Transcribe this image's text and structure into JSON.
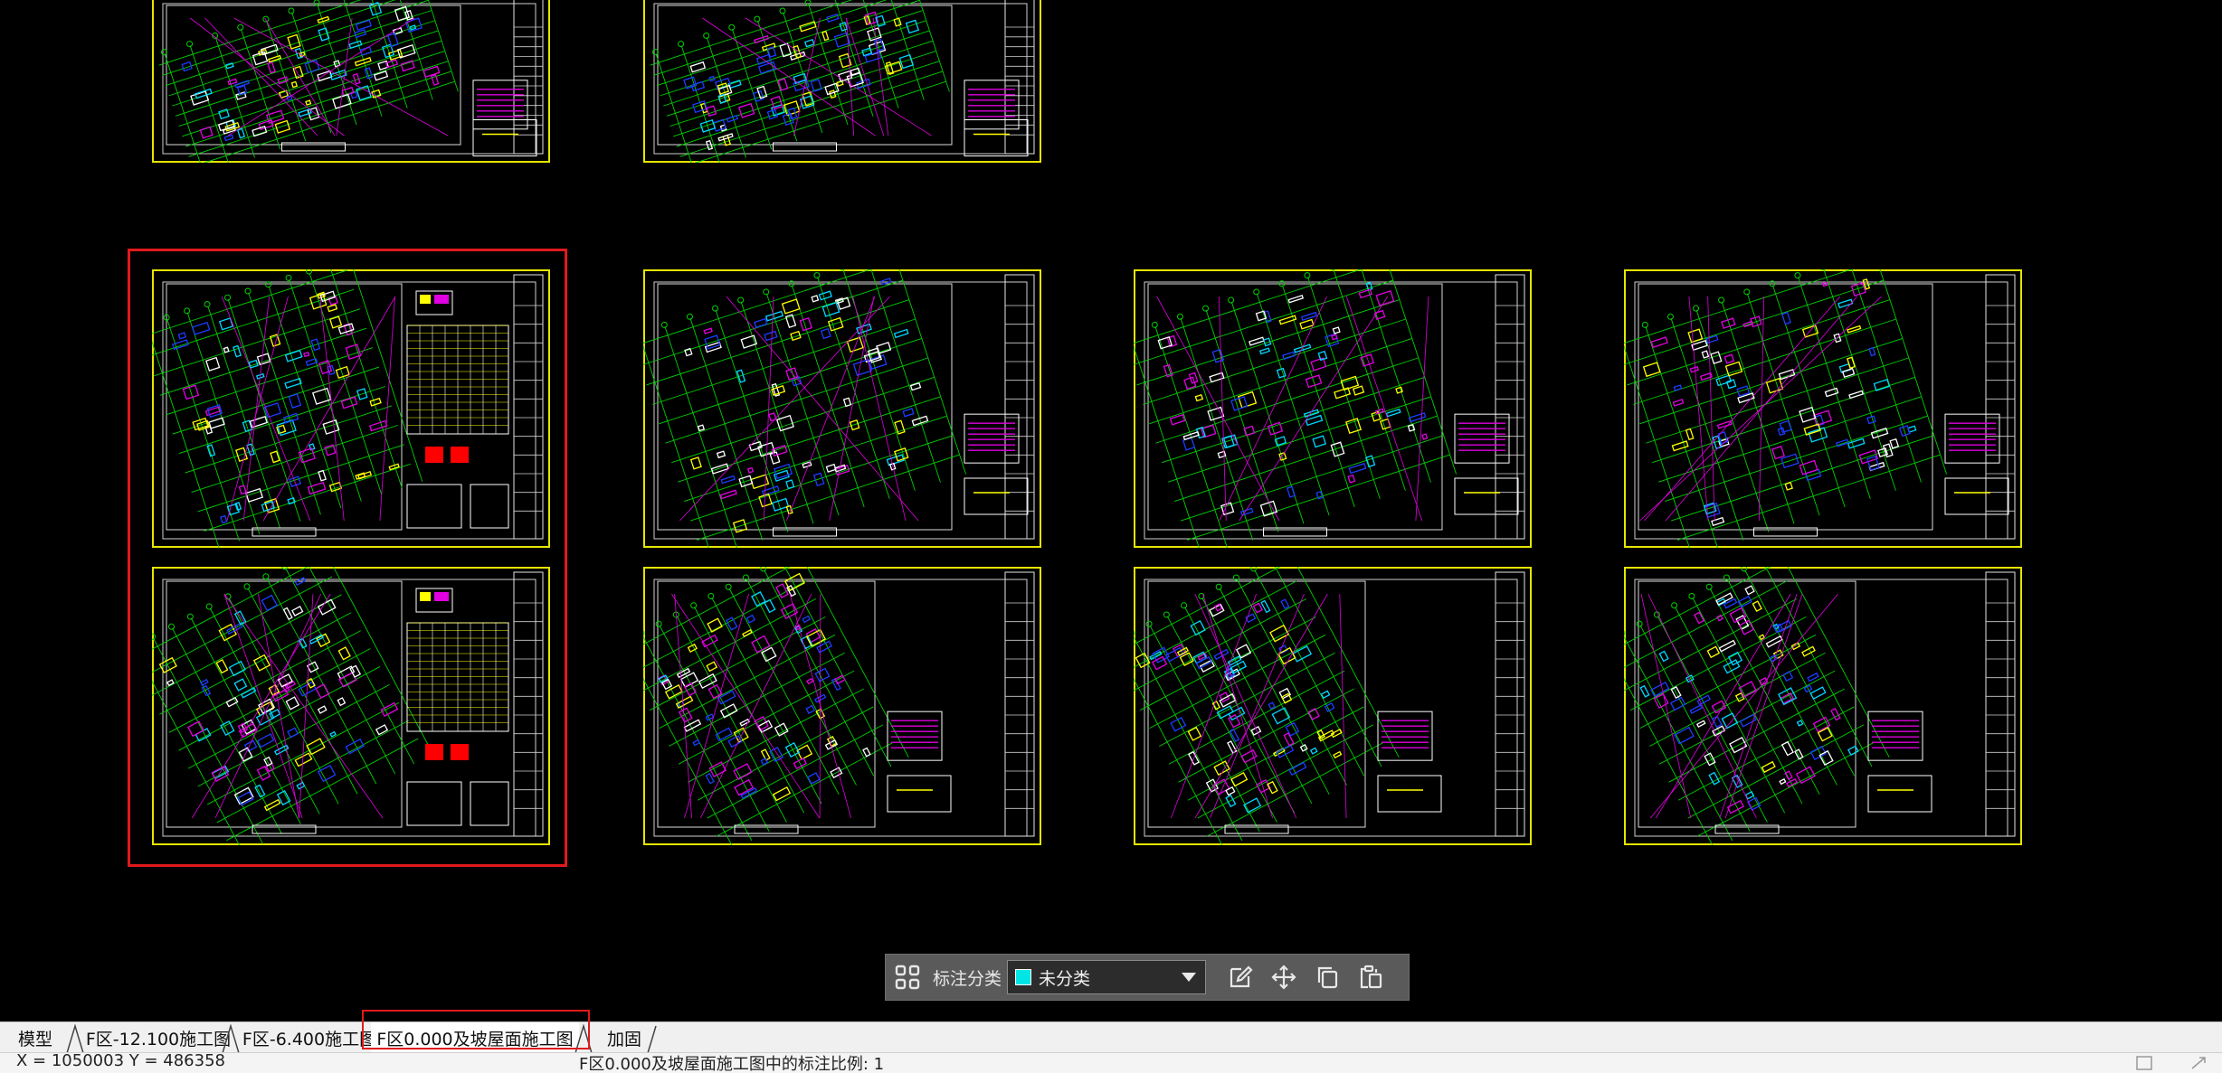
{
  "toolbar": {
    "category_label": "标注分类",
    "category_value": "未分类",
    "category_color": "#00e5e5"
  },
  "tabs": [
    {
      "label": "模型"
    },
    {
      "label": "F区-12.100施工图"
    },
    {
      "label": "F区-6.400施工图"
    },
    {
      "label": "F区0.000及坡屋面施工图",
      "active": true
    },
    {
      "label": "加固"
    }
  ],
  "status": {
    "coords": "X = 1050003    Y = 486358",
    "message": "F区0.000及坡屋面施工图中的标注比例: 1"
  },
  "colors": {
    "frame_border": "#e6e600",
    "grid_green": "#00d000",
    "structure_cyan": "#00d8ff",
    "structure_blue": "#1c3cff",
    "annotation_magenta": "#e000e0",
    "selection_red": "#e0191d"
  }
}
